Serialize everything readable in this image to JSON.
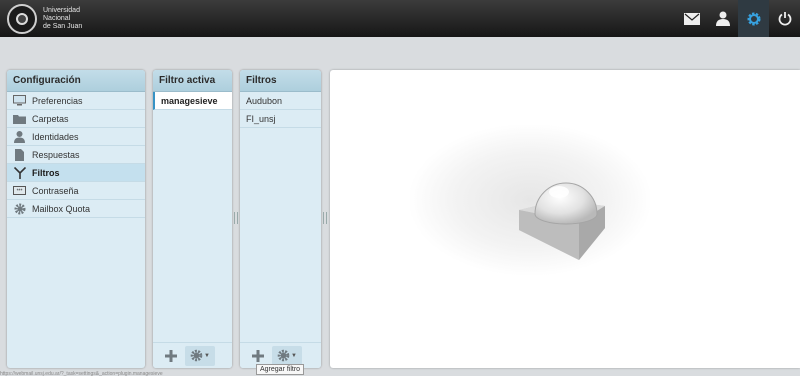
{
  "brand": {
    "line1": "Universidad",
    "line2": "Nacional",
    "line3": "de San Juan"
  },
  "topnav": [
    {
      "icon": "mail-icon",
      "label": "Correo"
    },
    {
      "icon": "contacts-icon",
      "label": "Contactos"
    },
    {
      "icon": "settings-icon",
      "label": "Configuración",
      "active": true
    },
    {
      "icon": "power-icon",
      "label": "Salir"
    }
  ],
  "config_panel": {
    "title": "Configuración",
    "items": [
      {
        "label": "Preferencias",
        "icon": "monitor-icon"
      },
      {
        "label": "Carpetas",
        "icon": "folder-icon"
      },
      {
        "label": "Identidades",
        "icon": "person-icon"
      },
      {
        "label": "Respuestas",
        "icon": "document-icon"
      },
      {
        "label": "Filtros",
        "icon": "filter-icon",
        "selected": true
      },
      {
        "label": "Contraseña",
        "icon": "password-icon"
      },
      {
        "label": "Mailbox Quota",
        "icon": "gear-icon"
      }
    ]
  },
  "filterset_panel": {
    "title": "Filtro activa",
    "items": [
      {
        "label": "managesieve",
        "selected": true
      }
    ]
  },
  "filters_panel": {
    "title": "Filtros",
    "items": [
      {
        "label": "Audubon"
      },
      {
        "label": "FI_unsj"
      }
    ]
  },
  "tooltip": "Agregar filtro",
  "status_text": "https://webmail.unsj.edu.ar/?_task=settings&_action=plugin.managesieve"
}
